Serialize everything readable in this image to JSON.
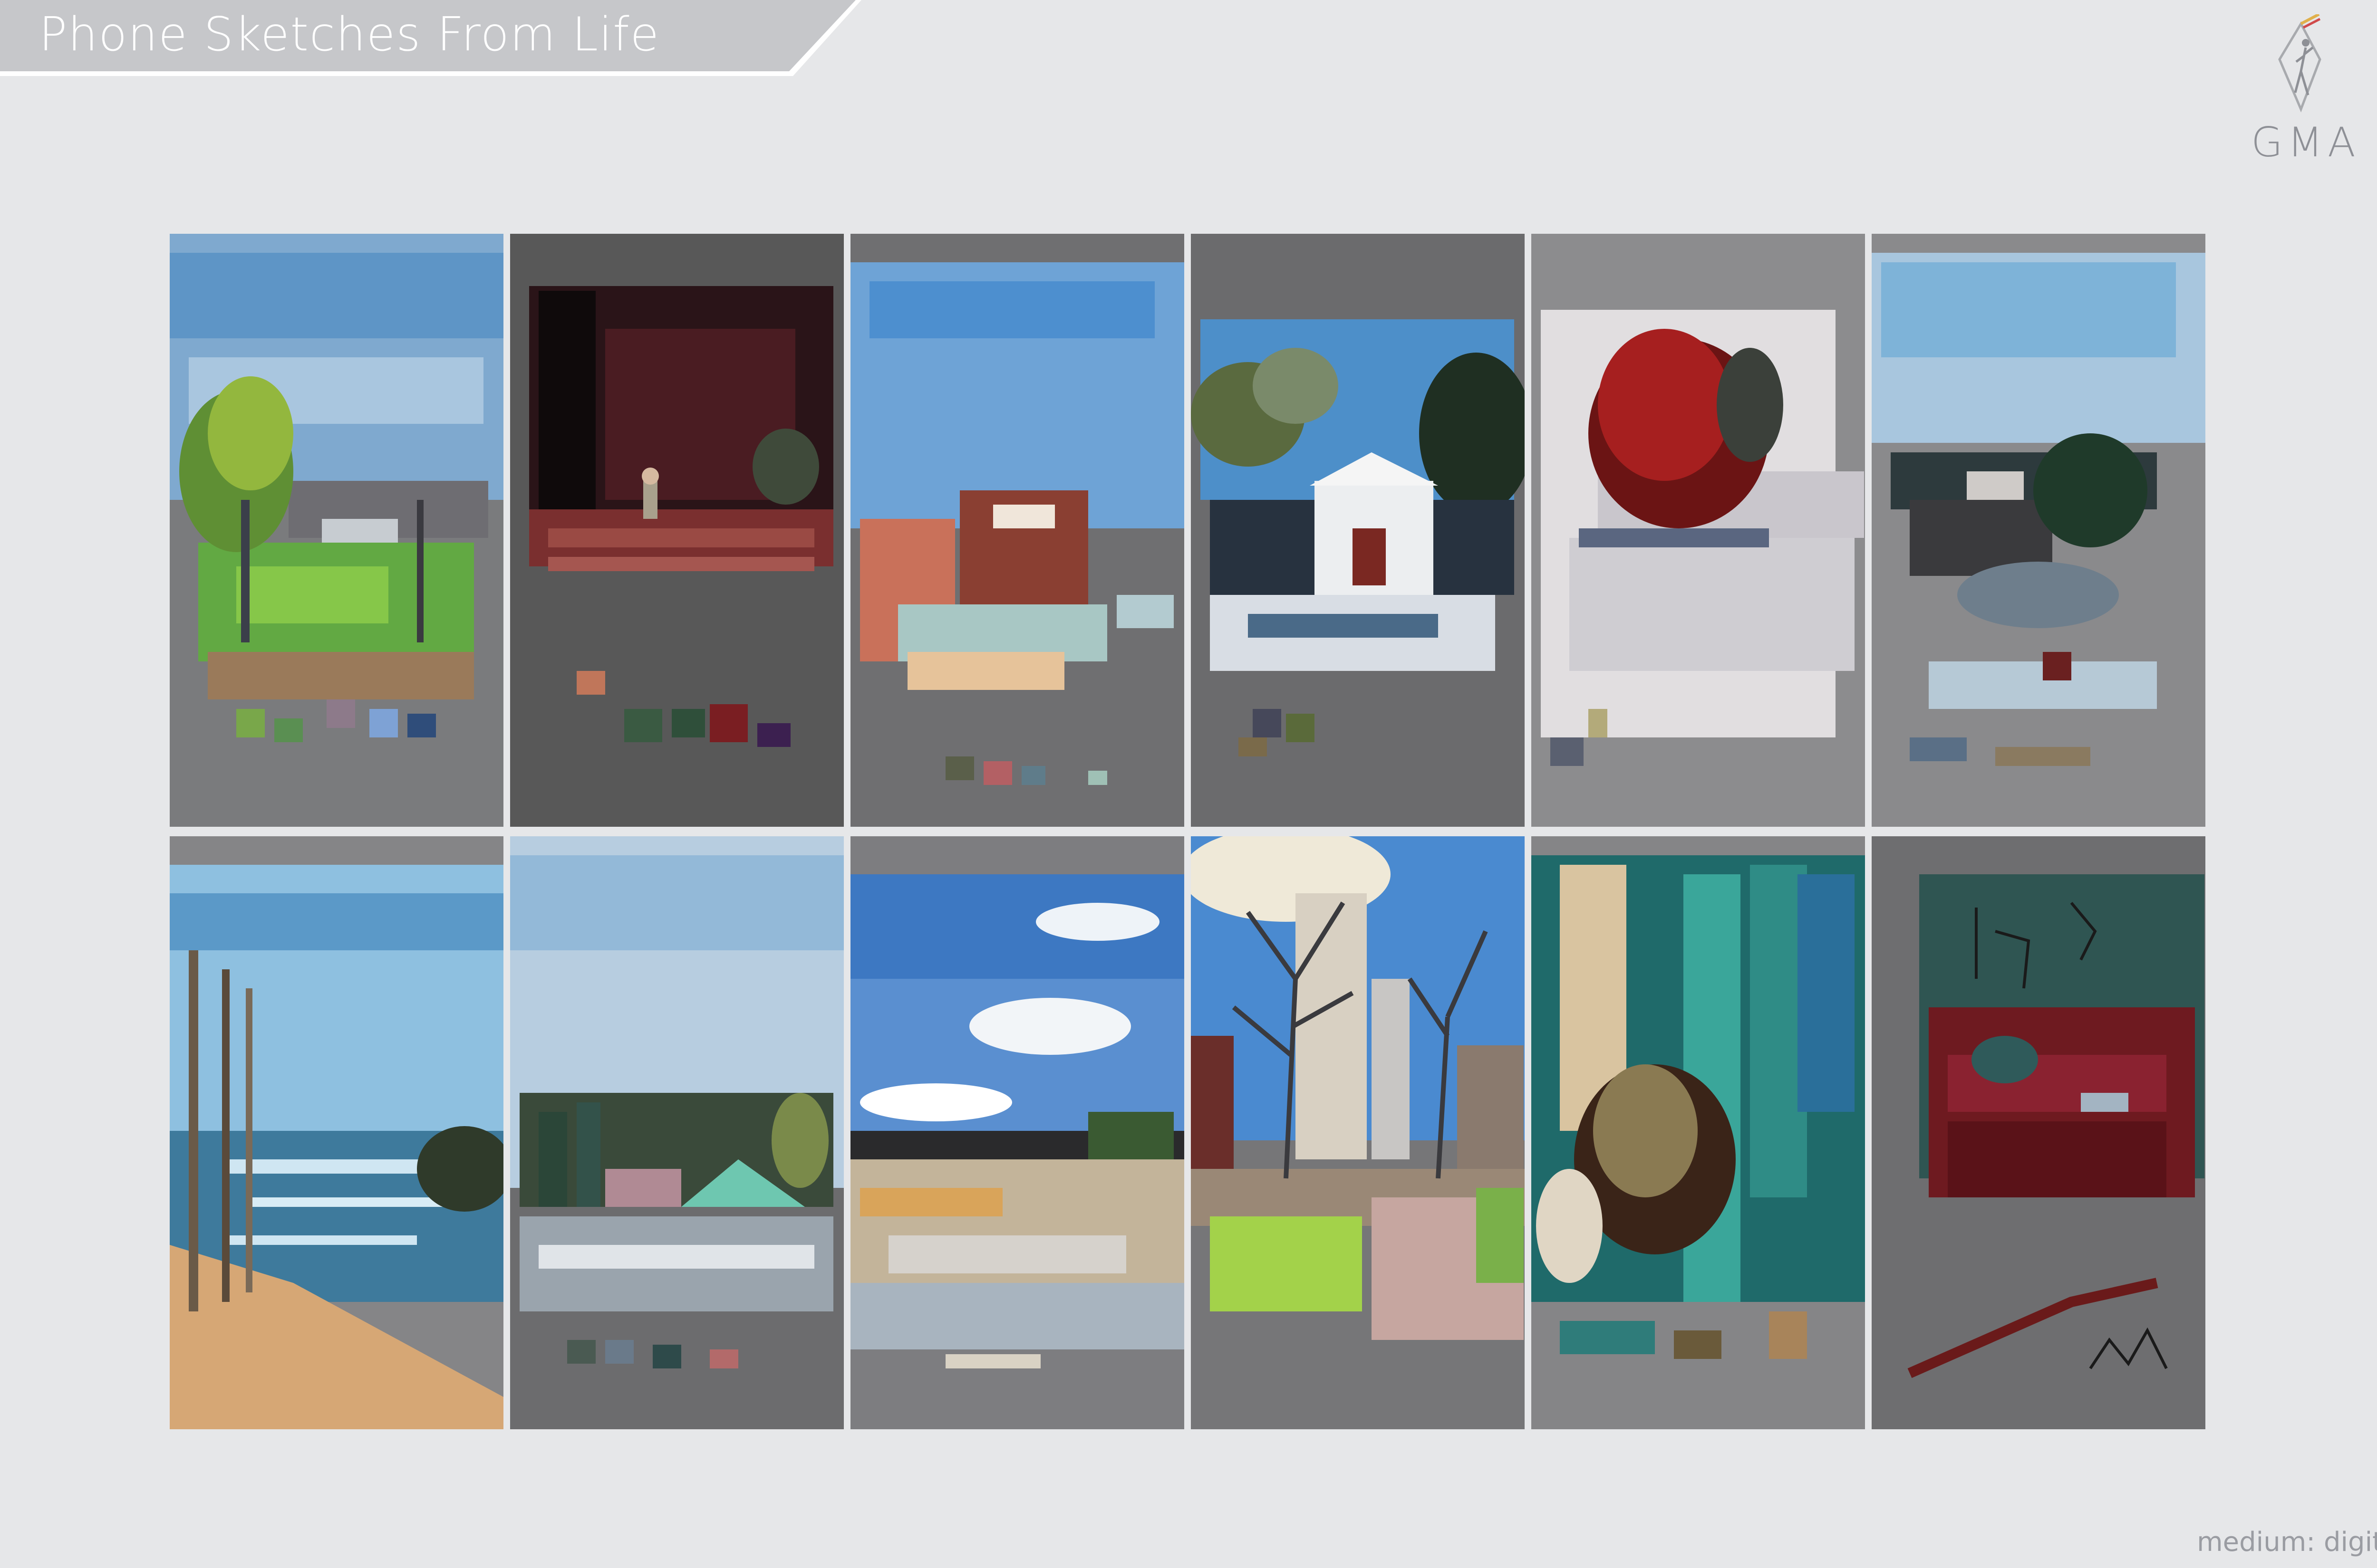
{
  "header": {
    "title": "Phone Sketches From Life"
  },
  "logo": {
    "text": "GMA",
    "icon": "gma-diamond-figure-logo"
  },
  "gallery": {
    "tiles": [
      {
        "id": "sketch-river-tree-house",
        "bg": "#7a7b7d"
      },
      {
        "id": "sketch-stage-performer",
        "bg": "#585858"
      },
      {
        "id": "sketch-brick-building",
        "bg": "#6f6f71"
      },
      {
        "id": "sketch-white-barn",
        "bg": "#6b6b6d"
      },
      {
        "id": "sketch-red-bush-snow",
        "bg": "#8c8c8e"
      },
      {
        "id": "sketch-houses-trees",
        "bg": "#8a8a8c"
      },
      {
        "id": "sketch-lake-shore",
        "bg": "#858587"
      },
      {
        "id": "sketch-pond-park",
        "bg": "#6c6c6e"
      },
      {
        "id": "sketch-clouds-road",
        "bg": "#7d7d80"
      },
      {
        "id": "sketch-bare-tree-monument",
        "bg": "#767678"
      },
      {
        "id": "sketch-interior-teal",
        "bg": "#858587"
      },
      {
        "id": "sketch-red-sofa",
        "bg": "#6e6e70"
      }
    ]
  },
  "footer": {
    "medium": "medium: digital"
  },
  "colors": {
    "background": "#e6e7e9",
    "banner": "#c6c7ca"
  }
}
